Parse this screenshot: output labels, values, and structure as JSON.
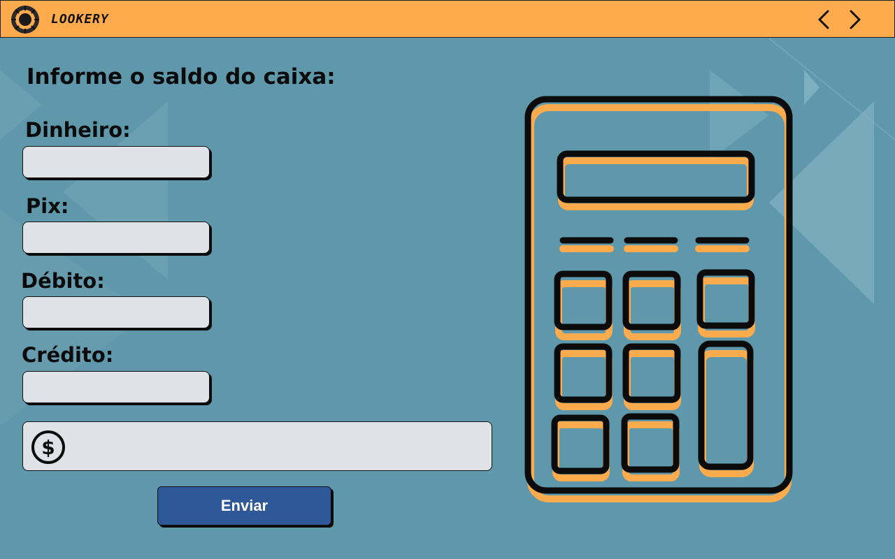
{
  "header": {
    "brand": "LOOKERY",
    "icons": {
      "logo": "camera-shutter-logo",
      "prev": "chevron-left-icon",
      "next": "chevron-right-icon"
    }
  },
  "form": {
    "title": "Informe o saldo do caixa:",
    "fields": [
      {
        "label": "Dinheiro:",
        "value": ""
      },
      {
        "label": "Pix:",
        "value": ""
      },
      {
        "label": "Débito:",
        "value": ""
      },
      {
        "label": "Crédito:",
        "value": ""
      }
    ],
    "total": {
      "icon": "dollar-circle-icon",
      "value": ""
    },
    "submit_label": "Enviar"
  },
  "illustration": {
    "icon": "calculator-icon"
  },
  "colors": {
    "background": "#5f97ab",
    "topbar": "#fdab4c",
    "accent_orange": "#fdab4c",
    "input_bg": "#dfe3e8",
    "button": "#2f5899",
    "ink": "#0b0b0b"
  }
}
